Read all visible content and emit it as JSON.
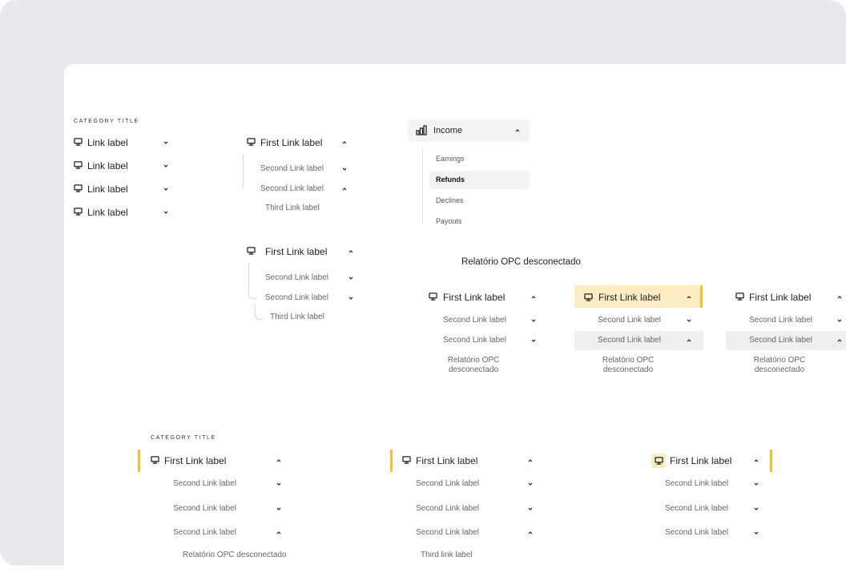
{
  "category_title": "CATEGORY TITLE",
  "link_label": "Link label",
  "first_link": "First Link label",
  "second_link": "Second Link label",
  "third_link": "Third Link label",
  "third_link_lower": "Third link label",
  "relatorio": "Relatório OPC desconectado",
  "relatorio_line1": "Relatório OPC",
  "relatorio_line2": "desconectado",
  "income": {
    "title": "Income",
    "items": [
      "Earnings",
      "Refunds",
      "Declines",
      "Payouts"
    ]
  },
  "icons": {
    "monitor": "monitor-icon",
    "chart": "bar-chart-icon",
    "chevron_down": "chevron-down-icon",
    "chevron_up": "chevron-up-icon"
  },
  "colors": {
    "accent": "#f2c130",
    "accent_bg": "#fbecc4",
    "hover_bg": "#efefef",
    "frame": "#e8e9ed"
  }
}
